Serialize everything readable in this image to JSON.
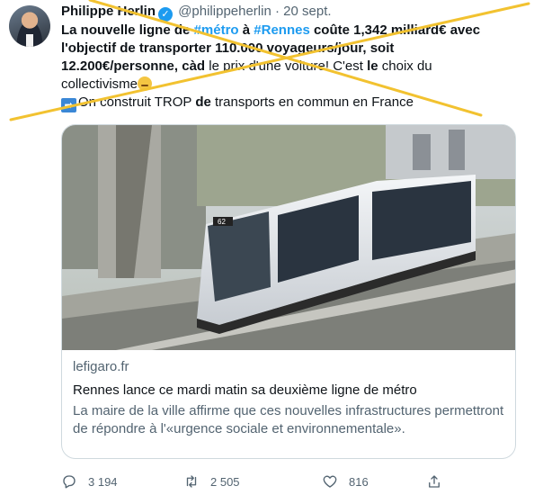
{
  "tweet": {
    "author_name": "Philippe Herlin",
    "handle": "@philippeherlin",
    "separator": "·",
    "date": "20 sept.",
    "text": {
      "p1": "La nouvelle ligne de ",
      "tag1": "#métro",
      "p2": " à ",
      "tag2": "#Rennes",
      "p3": " coûte 1,342 milliard€ avec l'objectif de transporter 110.000 voyageurs/jour, soit 12.200€/personne, càd ",
      "p4": "le prix d'une voiture! C'est ",
      "p5": "le",
      "p6": " choix du collectivisme",
      "p7": "On construit TROP ",
      "p8": "de",
      "p9": " transports en commun en France"
    }
  },
  "card": {
    "domain": "lefigaro.fr",
    "title": "Rennes lance ce mardi matin sa deuxième ligne de métro",
    "description": "La maire de la ville affirme que ces nouvelles infrastructures permettront de répondre à l'«urgence sociale et environnementale».",
    "image_label": "62"
  },
  "actions": {
    "replies": "3 194",
    "retweets": "2 505",
    "likes": "816"
  },
  "colors": {
    "accent": "#1d9bf0",
    "strike": "#f2c230",
    "secondary_text": "#536471"
  },
  "icons": [
    "verified-badge-icon",
    "reply-icon",
    "retweet-icon",
    "like-icon",
    "share-icon",
    "right-arrow-emoji",
    "grimace-emoji"
  ]
}
